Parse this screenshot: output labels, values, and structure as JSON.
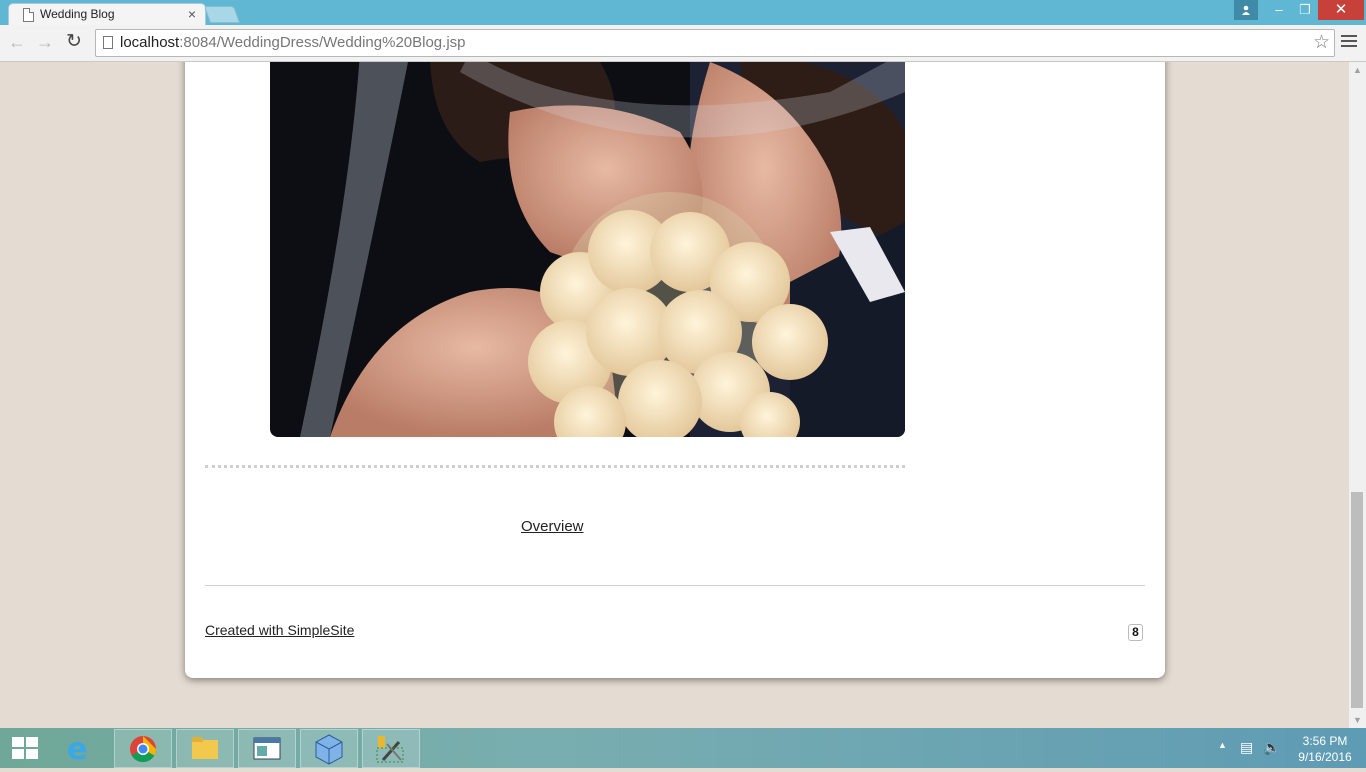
{
  "browser": {
    "tab_title": "Wedding Blog",
    "tab_close": "×",
    "url_host": "localhost",
    "url_rest": ":8084/WeddingDress/Wedding%20Blog.jsp",
    "back_icon": "arrow-left-icon",
    "forward_icon": "arrow-right-icon",
    "reload_icon": "reload-icon",
    "bookmark_icon": "star-icon",
    "menu_icon": "hamburger-icon"
  },
  "window": {
    "min": "–",
    "max": "❐",
    "close": "✕"
  },
  "page": {
    "photo_desc": "bride-and-groom-kissing-under-veil",
    "overview_link": "Overview",
    "footer_link": "Created with SimpleSite",
    "badge": "8"
  },
  "taskbar": {
    "apps": [
      "internet-explorer-icon",
      "chrome-icon",
      "file-explorer-icon",
      "app-window-icon",
      "virtualbox-icon",
      "tools-icon"
    ],
    "time": "3:56 PM",
    "date": "9/16/2016"
  },
  "colors": {
    "titlebar": "#5fb7d3",
    "page_bg": "#e4dcd2",
    "close_button": "#c7403a"
  }
}
